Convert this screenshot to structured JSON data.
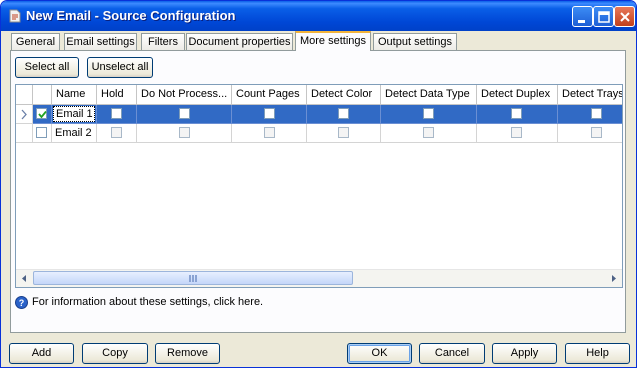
{
  "window": {
    "title": "New Email - Source Configuration"
  },
  "tabs": [
    {
      "label": "General"
    },
    {
      "label": "Email settings"
    },
    {
      "label": "Filters"
    },
    {
      "label": "Document properties"
    },
    {
      "label": "More settings"
    },
    {
      "label": "Output settings"
    }
  ],
  "toolbar": {
    "select_all": "Select all",
    "unselect_all": "Unselect all"
  },
  "grid": {
    "columns": [
      "Name",
      "Hold",
      "Do Not Process...",
      "Count Pages",
      "Detect Color",
      "Detect Data Type",
      "Detect Duplex",
      "Detect Trays"
    ],
    "rows": [
      {
        "checked": true,
        "name": "Email 1"
      },
      {
        "checked": false,
        "name": "Email 2"
      }
    ]
  },
  "info": {
    "text": "For information about these settings, click here."
  },
  "buttons": {
    "add": "Add",
    "copy": "Copy",
    "remove": "Remove",
    "ok": "OK",
    "cancel": "Cancel",
    "apply": "Apply",
    "help": "Help"
  }
}
